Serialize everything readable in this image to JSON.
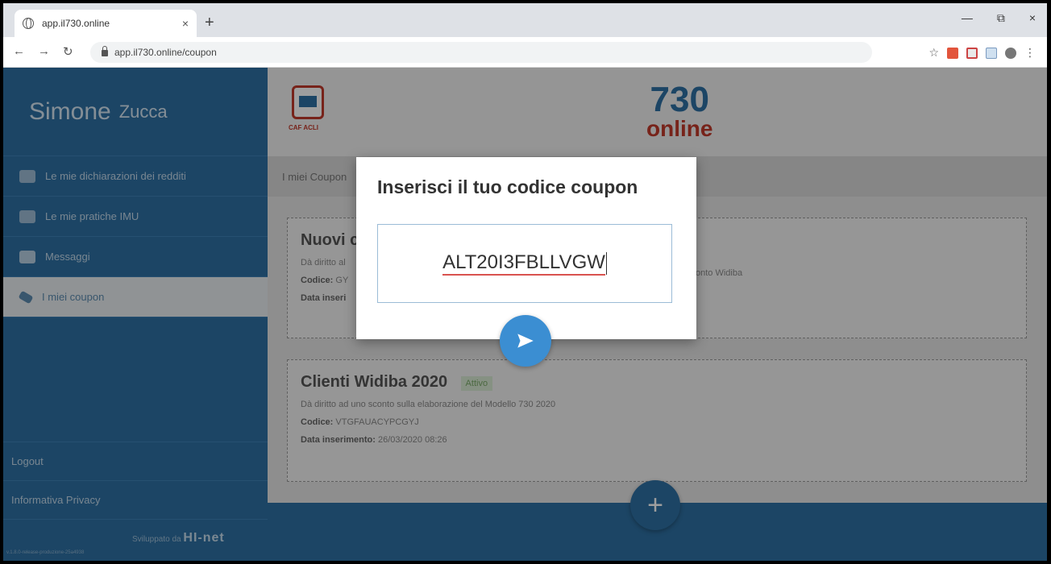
{
  "browser": {
    "tab_title": "app.il730.online",
    "tab_close": "×",
    "new_tab": "+",
    "url": "app.il730.online/coupon",
    "win_min": "—",
    "win_restore": "⧉",
    "win_close": "×"
  },
  "user": {
    "first_name": "Simone",
    "last_name": "Zucca"
  },
  "menu": {
    "items": [
      {
        "label": "Le mie dichiarazioni dei redditi",
        "icon": "730-doc-icon"
      },
      {
        "label": "Le mie pratiche IMU",
        "icon": "house-icon"
      },
      {
        "label": "Messaggi",
        "icon": "message-icon"
      },
      {
        "label": "I miei coupon",
        "icon": "coupon-tag-icon"
      }
    ],
    "logout": "Logout",
    "privacy": "Informativa Privacy",
    "developed_by": "Sviluppato da",
    "developer": "HI-net",
    "version": "v.1.8.0-release-produzione-25a4938"
  },
  "header": {
    "logo_caption": "CAF ACLI",
    "brand_number": "730",
    "brand_word": "online"
  },
  "breadcrumb": "I miei Coupon",
  "coupons": [
    {
      "title": "Nuovi c",
      "desc_start": "Dà diritto al",
      "desc_end": "onto Widiba",
      "code_label": "Codice:",
      "code": "GY",
      "date_label": "Data inseri"
    },
    {
      "title": "Clienti Widiba 2020",
      "status": "Attivo",
      "description": "Dà diritto ad uno sconto sulla elaborazione del Modello 730 2020",
      "code_label": "Codice:",
      "code": "VTGFAUACYPCGYJ",
      "date_label": "Data inserimento:",
      "date": "26/03/2020 08:26"
    }
  ],
  "fab": "+",
  "modal": {
    "title": "Inserisci il tuo codice coupon",
    "coupon_value": "ALT20I3FBLLVGW"
  },
  "colors": {
    "primary": "#2e70a3",
    "accent_red": "#c0392b",
    "send_button": "#3b8ed2"
  }
}
